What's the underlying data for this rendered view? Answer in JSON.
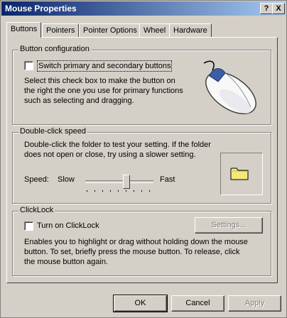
{
  "window": {
    "title": "Mouse Properties",
    "help_glyph": "?",
    "close_glyph": "X"
  },
  "tabs": [
    {
      "label": "Buttons"
    },
    {
      "label": "Pointers"
    },
    {
      "label": "Pointer Options"
    },
    {
      "label": "Wheel"
    },
    {
      "label": "Hardware"
    }
  ],
  "button_config": {
    "group_label": "Button configuration",
    "checkbox_label": "Switch primary and secondary buttons",
    "checked": false,
    "description": "Select this check box to make the button on the right the one you use for primary functions such as selecting and dragging."
  },
  "double_click": {
    "group_label": "Double-click speed",
    "description": "Double-click the folder to test your setting. If the folder does not open or close, try using a slower setting.",
    "speed_label": "Speed:",
    "slow_label": "Slow",
    "fast_label": "Fast",
    "speed_level": 0.6
  },
  "clicklock": {
    "group_label": "ClickLock",
    "checkbox_label": "Turn on ClickLock",
    "checked": false,
    "settings_button": "Settings...",
    "description": "Enables you to highlight or drag without holding down the mouse button. To set, briefly press the mouse button. To release, click the mouse button again."
  },
  "footer": {
    "ok": "OK",
    "cancel": "Cancel",
    "apply": "Apply"
  }
}
